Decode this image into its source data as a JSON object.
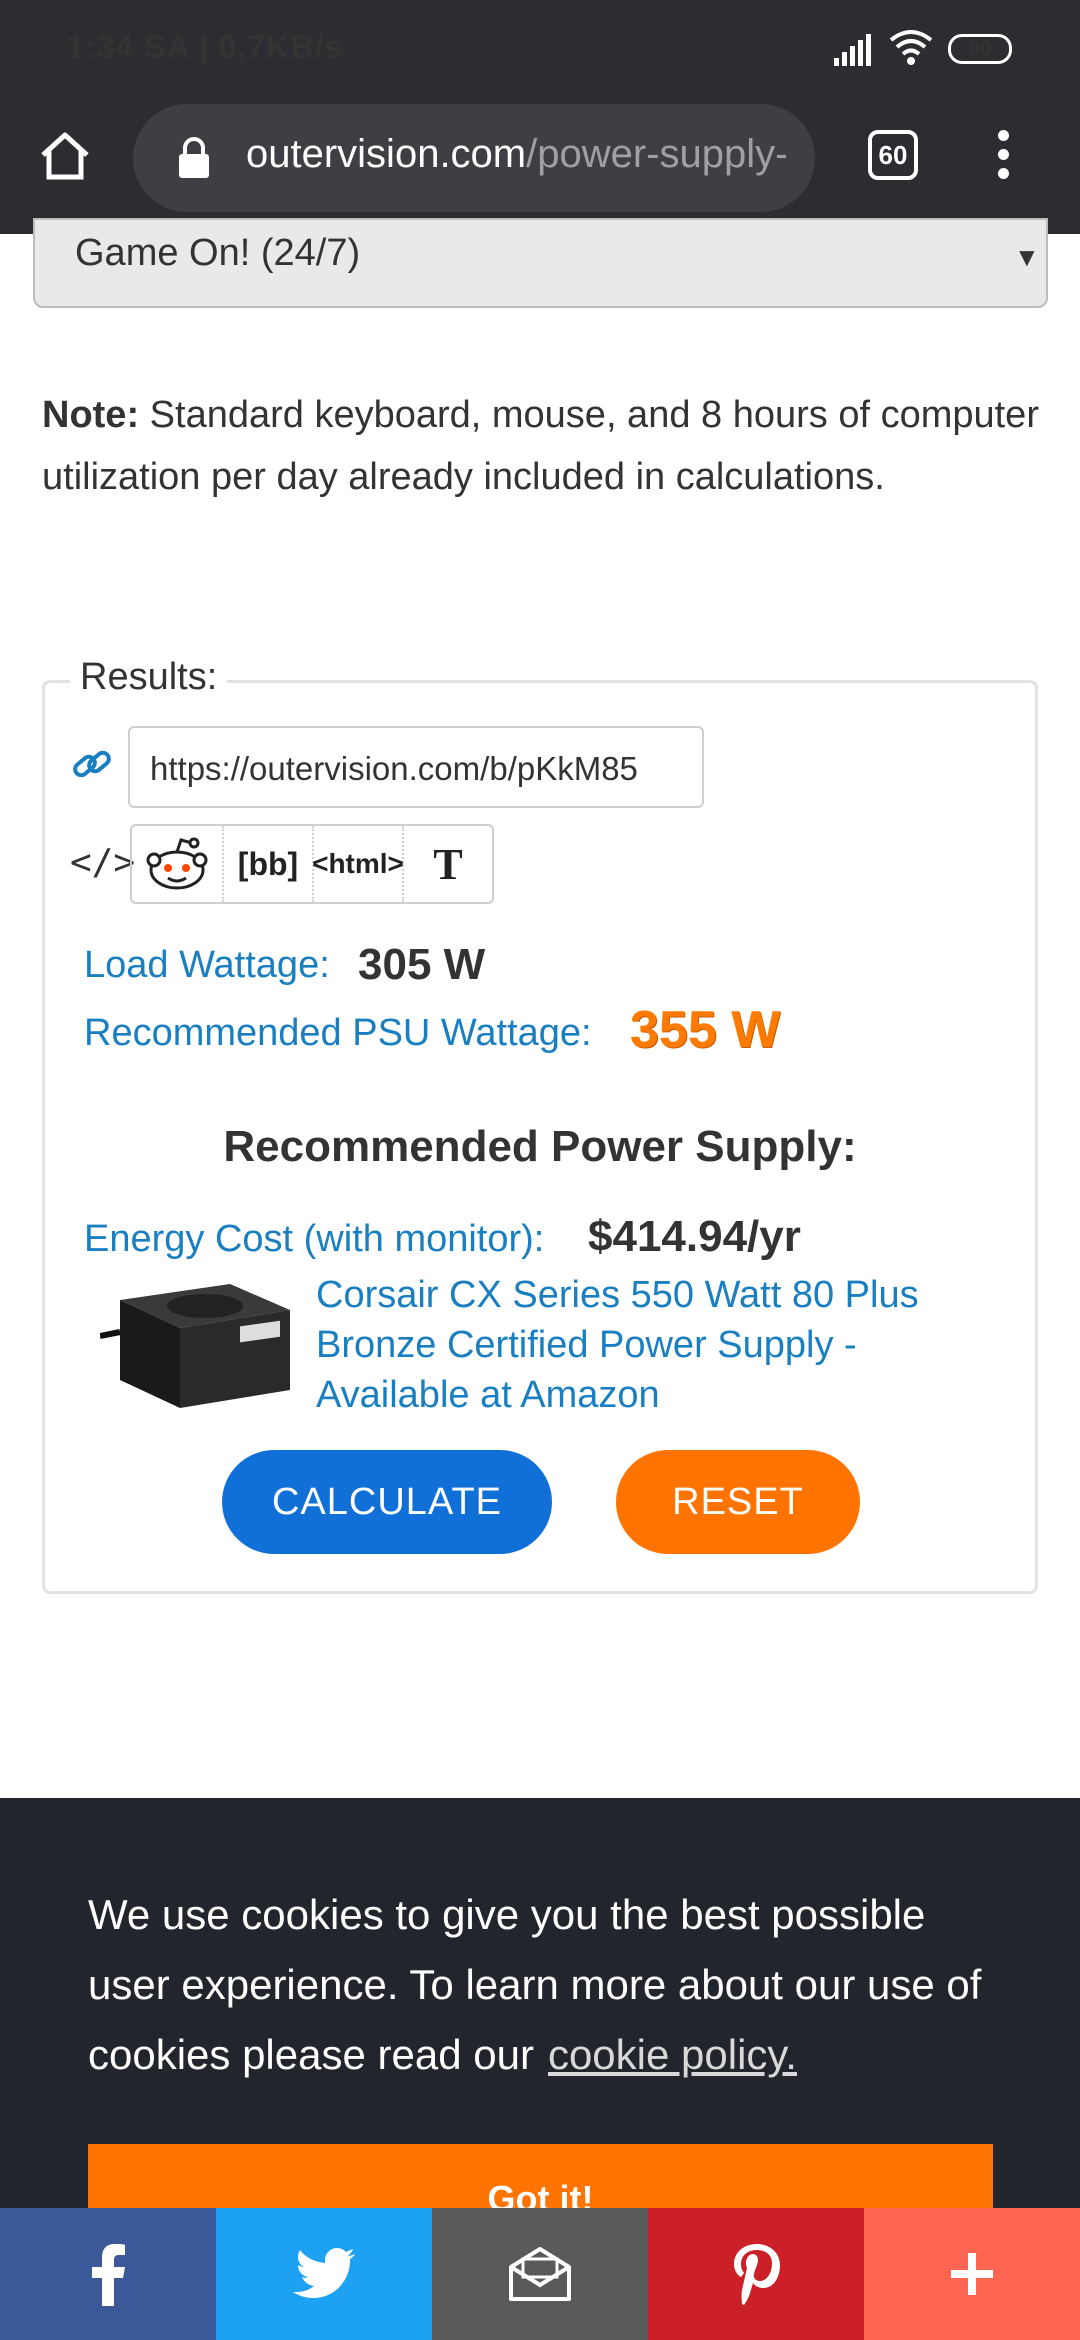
{
  "status_bar": {
    "time_speed": "1:34 SA | 0,7KB/s",
    "battery": "80"
  },
  "browser": {
    "url_domain": "outervision.com",
    "url_path": "/power-supply-calculator",
    "tab_count": "60"
  },
  "form": {
    "usage_select_value": "Game On! (24/7)",
    "note_label": "Note:",
    "note_text": " Standard keyboard, mouse, and 8 hours of computer utilization per day already included in calculations."
  },
  "results": {
    "legend": "Results:",
    "share_url": "https://outervision.com/b/pKkM85",
    "share_bb": "[bb]",
    "share_html": "<html>",
    "share_text": "T",
    "load_label": "Load Wattage:",
    "load_value": "305 W",
    "psu_label": "Recommended PSU Wattage:",
    "psu_value": "355 W",
    "rec_title": "Recommended Power Supply:",
    "energy_label": "Energy Cost (with monitor):",
    "energy_value": "$414.94/yr",
    "product_link": "Corsair CX Series 550 Watt 80 Plus Bronze Certified Power Supply - Available at Amazon",
    "calculate": "CALCULATE",
    "reset": "RESET"
  },
  "cookie": {
    "text": "We use cookies to give you the best possible user experience. To learn more about our use of cookies please read our",
    "link": "cookie policy.",
    "button": "Got it!"
  },
  "colors": {
    "accent_blue": "#1a7fc1",
    "calc_button": "#1170d8",
    "orange": "#ff7300",
    "facebook": "#3b5998",
    "twitter": "#1da1f2",
    "pinterest": "#cb2027"
  },
  "icons": {
    "share_bar": [
      "facebook-icon",
      "twitter-icon",
      "email-icon",
      "pinterest-icon",
      "plus-icon"
    ]
  }
}
